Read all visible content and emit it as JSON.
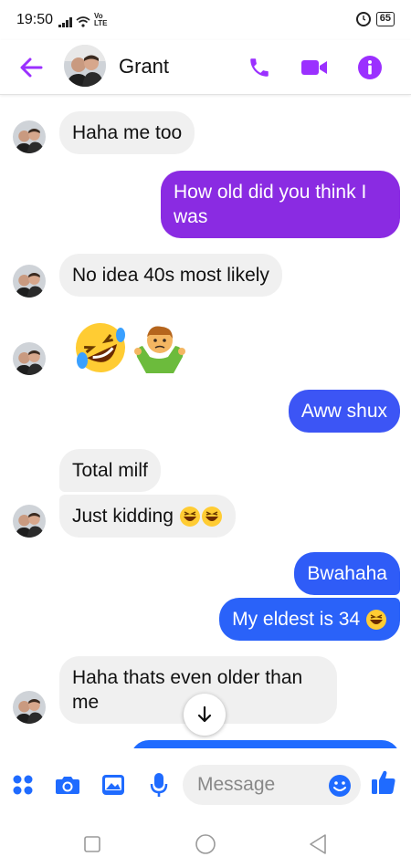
{
  "status_bar": {
    "time": "19:50",
    "network": "Vo LTE",
    "battery": "65"
  },
  "header": {
    "contact_name": "Grant"
  },
  "messages": [
    {
      "side": "in",
      "text": "Haha me too"
    },
    {
      "side": "out",
      "text": "How old did you think I was"
    },
    {
      "side": "in",
      "text": "No idea 40s most likely"
    },
    {
      "side": "in",
      "emoji": [
        "rolling-on-floor-laughing",
        "man-shrugging"
      ]
    },
    {
      "side": "out",
      "text": "Aww shux"
    },
    {
      "side": "in",
      "text": "Total milf"
    },
    {
      "side": "in",
      "text": "Just kidding",
      "emoji": [
        "rolling-on-floor-laughing",
        "rolling-on-floor-laughing"
      ]
    },
    {
      "side": "out",
      "text": "Bwahaha"
    },
    {
      "side": "out",
      "text": "My eldest is 34",
      "emoji": [
        "rolling-on-floor-laughing"
      ]
    },
    {
      "side": "in",
      "text": "Haha thats even older than me"
    }
  ],
  "composer": {
    "placeholder": "Message"
  },
  "colors": {
    "accent": "#9b30ff",
    "outgoing_top": "#8a2be2",
    "outgoing_bottom": "#1f6bff",
    "incoming": "#f0f0f0"
  },
  "icons": [
    "back-arrow-icon",
    "phone-icon",
    "video-icon",
    "info-icon",
    "more-apps-icon",
    "camera-icon",
    "gallery-icon",
    "mic-icon",
    "smile-icon",
    "thumbs-up-icon",
    "scroll-down-icon"
  ]
}
